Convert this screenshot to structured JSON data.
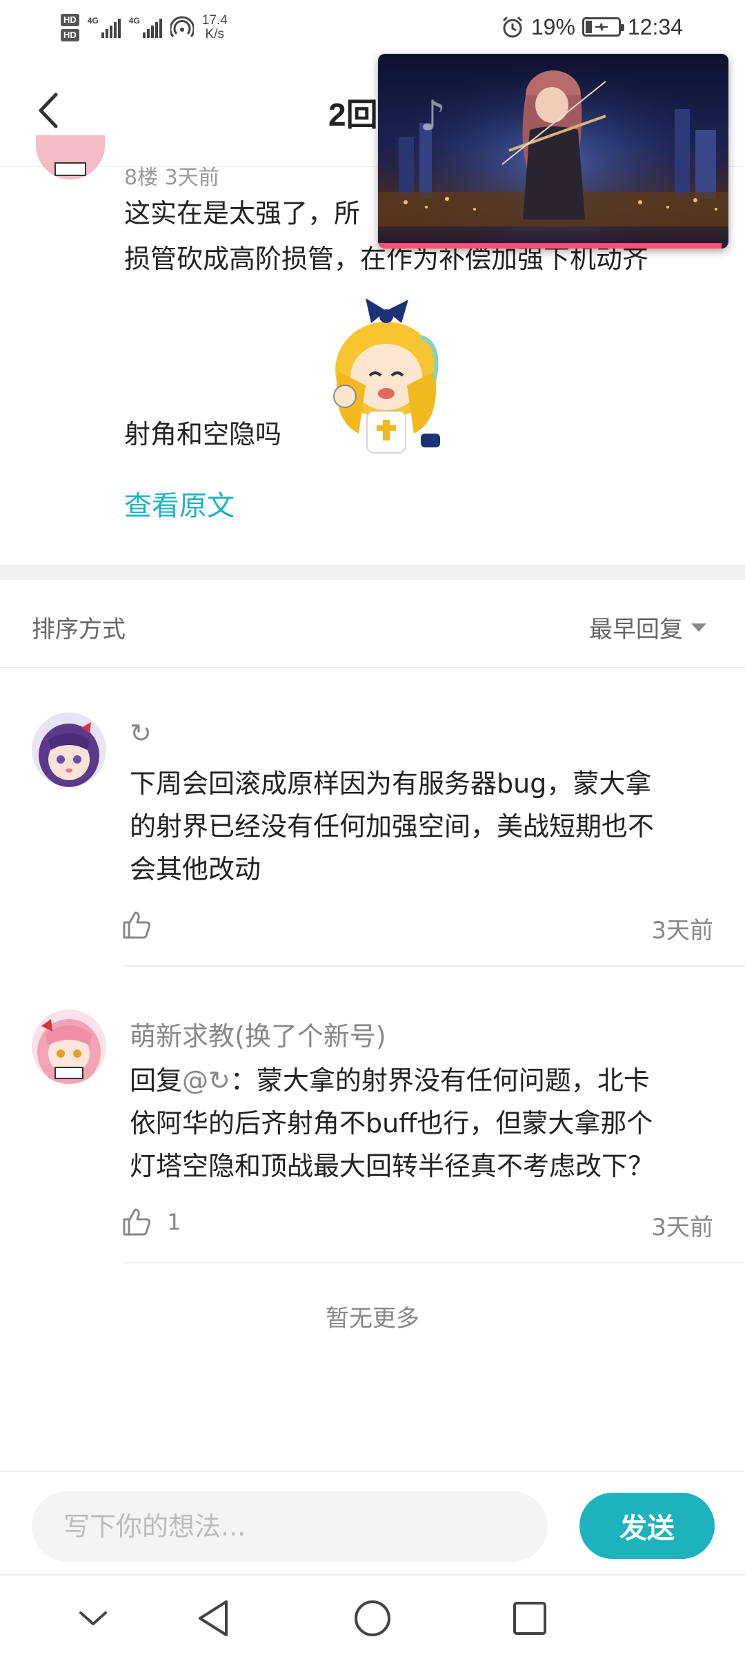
{
  "status_bar": {
    "hd1": "HD",
    "hd2": "HD",
    "net1": "4G",
    "net2": "4G",
    "speed_value": "17.4",
    "speed_unit": "K/s",
    "battery": "19%",
    "time": "12:34"
  },
  "header": {
    "title": "2回"
  },
  "post": {
    "meta": "8楼  3天前",
    "lines": [
      "这实在是太强了，所",
      "损管砍成高阶损管，在作为补偿加强下机动齐",
      "射角和空隐吗"
    ],
    "view_original": "查看原文"
  },
  "sort": {
    "label": "排序方式",
    "value": "最早回复"
  },
  "replies": [
    {
      "name": "↻",
      "lines": [
        "下周会回滚成原样因为有服务器bug，蒙大拿",
        "的射界已经没有任何加强空间，美战短期也不",
        "会其他改动"
      ],
      "likes": "",
      "time": "3天前"
    },
    {
      "name": "萌新求教(换了个新号)",
      "reply_prefix": "回复",
      "reply_to": "@↻",
      "lines": [
        "：蒙大拿的射界没有任何问题，北卡",
        "依阿华的后齐射角不buff也行，但蒙大拿那个",
        "灯塔空隐和顶战最大回转半径真不考虑改下？"
      ],
      "likes": "1",
      "time": "3天前"
    }
  ],
  "no_more": "暂无更多",
  "composer": {
    "placeholder": "写下你的想法...",
    "send": "发送"
  },
  "video": {
    "progress": 0.98
  },
  "colors": {
    "accent": "#1db3bd",
    "progress": "#ff4e7a"
  }
}
